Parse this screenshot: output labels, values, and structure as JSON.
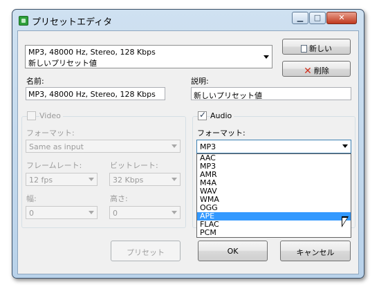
{
  "window": {
    "title": "プリセットエディタ",
    "min_glyph": "▁",
    "max_glyph": "□",
    "close_glyph": "✕"
  },
  "preset_combo": {
    "line1": "MP3, 48000 Hz, Stereo, 128 Kbps",
    "line2": "新しいプリセット値"
  },
  "buttons": {
    "new": "新しい",
    "delete": "削除",
    "preset": "プリセット",
    "ok": "OK",
    "cancel": "キャンセル"
  },
  "name": {
    "label": "名前:",
    "value": "MP3, 48000 Hz, Stereo, 128 Kbps"
  },
  "description": {
    "label": "説明:",
    "value": "新しいプリセット値"
  },
  "video": {
    "label": "Video",
    "checked": false,
    "format_label": "フォーマット:",
    "format_value": "Same as input",
    "framerate_label": "フレームレート:",
    "framerate_value": "12 fps",
    "bitrate_label": "ビットレート:",
    "bitrate_value": "32 Kbps",
    "width_label": "幅:",
    "width_value": "0",
    "height_label": "高さ:",
    "height_value": "0"
  },
  "audio": {
    "label": "Audio",
    "checked": true,
    "format_label": "フォーマット:",
    "format_value": "MP3",
    "options": [
      "AAC",
      "MP3",
      "AMR",
      "M4A",
      "WAV",
      "WMA",
      "OGG",
      "APE",
      "FLAC",
      "PCM"
    ],
    "highlighted_option": "APE"
  },
  "icons": {
    "new": "document-icon",
    "delete": "red-x-icon",
    "app": "app-icon",
    "cursor": "mouse-pointer-icon"
  },
  "colors": {
    "selection": "#3399ff",
    "delete_icon": "#d0311e"
  }
}
